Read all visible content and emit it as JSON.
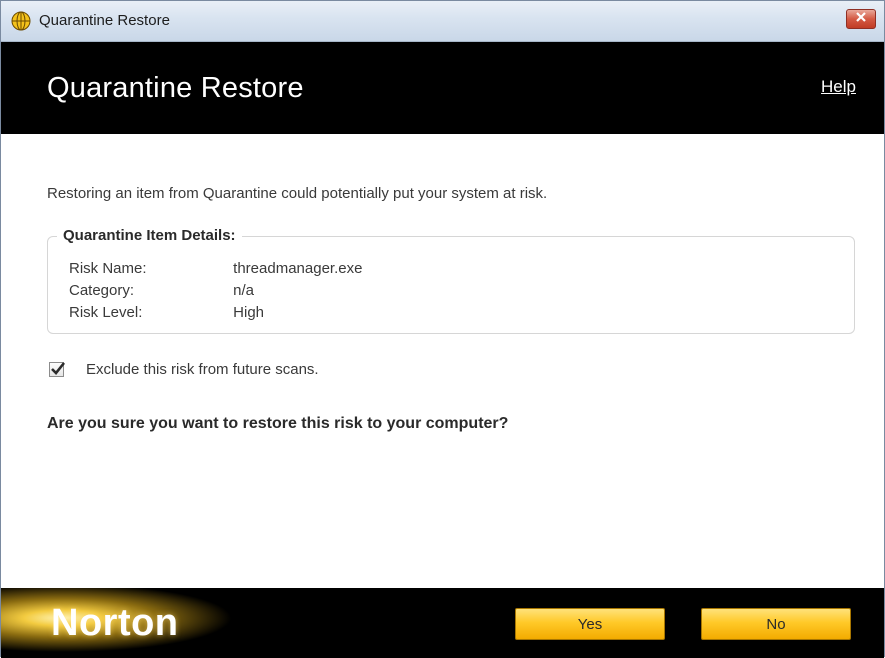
{
  "window": {
    "title": "Quarantine Restore"
  },
  "header": {
    "title": "Quarantine Restore",
    "help_label": "Help"
  },
  "content": {
    "intro": "Restoring an item from Quarantine could potentially put your system at risk.",
    "details": {
      "legend": "Quarantine Item Details:",
      "rows": [
        {
          "label": "Risk Name:",
          "value": "threadmanager.exe"
        },
        {
          "label": "Category:",
          "value": "n/a"
        },
        {
          "label": "Risk Level:",
          "value": "High"
        }
      ]
    },
    "exclude": {
      "checked": true,
      "label": "Exclude this risk from future scans."
    },
    "question": "Are you sure you want to restore this risk to your computer?"
  },
  "footer": {
    "brand": "Norton",
    "yes_label": "Yes",
    "no_label": "No"
  },
  "colors": {
    "header_bg": "#000000",
    "button_gold": "#ffc928",
    "close_red": "#c13c25"
  },
  "icons": {
    "app": "globe-icon",
    "close": "close-icon",
    "check": "checkmark-icon"
  }
}
